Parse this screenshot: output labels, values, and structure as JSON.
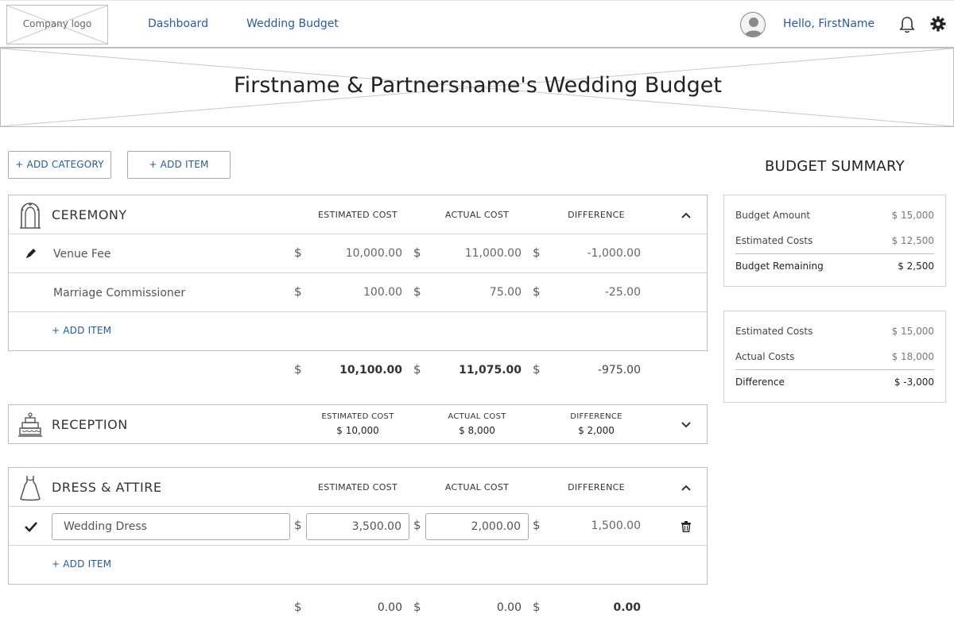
{
  "header": {
    "logo_text": "Company logo",
    "nav": [
      "Dashboard",
      "Wedding Budget"
    ],
    "greeting": "Hello, FirstName"
  },
  "banner": {
    "title": "Firstname & Partnersname's Wedding Budget"
  },
  "toolbar": {
    "add_category": "+ ADD CATEGORY",
    "add_item": "+ ADD ITEM"
  },
  "columns": {
    "estimated": "ESTIMATED COST",
    "actual": "ACTUAL COST",
    "difference": "DIFFERENCE"
  },
  "currency": "$",
  "ceremony": {
    "title": "CEREMONY",
    "icon": "arch-icon",
    "items": [
      {
        "name": "Venue Fee",
        "estimated": "10,000.00",
        "actual": "11,000.00",
        "difference": "-1,000.00"
      },
      {
        "name": "Marriage Commissioner",
        "estimated": "100.00",
        "actual": "75.00",
        "difference": "-25.00"
      }
    ],
    "add_item": "+ ADD ITEM",
    "totals": {
      "estimated": "10,100.00",
      "actual": "11,075.00",
      "difference": "-975.00"
    }
  },
  "reception": {
    "title": "RECEPTION",
    "icon": "cake-icon",
    "estimated": "$ 10,000",
    "actual": "$ 8,000",
    "difference": "$ 2,000"
  },
  "attire": {
    "title": "DRESS & ATTIRE",
    "icon": "dress-icon",
    "edit_item": {
      "name": "Wedding Dress",
      "estimated": "3,500.00",
      "actual": "2,000.00",
      "difference": "1,500.00"
    },
    "add_item": "+ ADD ITEM",
    "totals": {
      "estimated": "0.00",
      "actual": "0.00",
      "difference": "0.00"
    }
  },
  "summary": {
    "title": "BUDGET SUMMARY",
    "box1": [
      {
        "label": "Budget Amount",
        "value": "$ 15,000"
      },
      {
        "label": "Estimated Costs",
        "value": "$ 12,500"
      },
      {
        "label": "Budget Remaining",
        "value": "$ 2,500"
      }
    ],
    "box2": [
      {
        "label": "Estimated Costs",
        "value": "$ 15,000"
      },
      {
        "label": "Actual Costs",
        "value": "$ 18,000"
      },
      {
        "label": "Difference",
        "value": "$ -3,000"
      }
    ]
  }
}
